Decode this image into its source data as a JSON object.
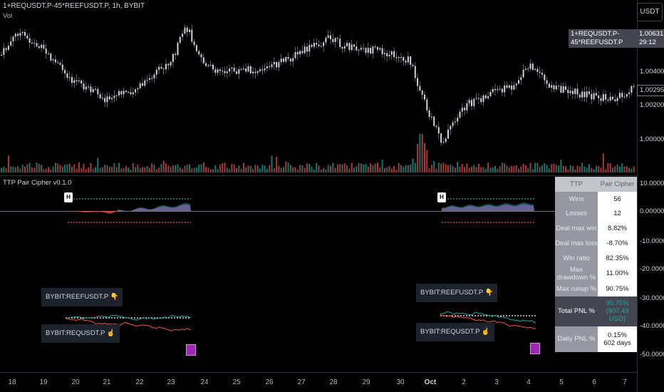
{
  "header": {
    "symbol_line": "1+REQUSDT.P-45*REEFUSDT.P, 1h, BYBIT",
    "vol_label": "Vol",
    "currency_button": "USDT"
  },
  "price_axis": {
    "labels": [
      "1.00400",
      "1.00200",
      "1.00000"
    ],
    "symbol_tag": "1+REQUSDT.P-45*REEFUSDT.P",
    "last_price": "1.00631",
    "countdown": "29:12",
    "cursor_price": "1.00295"
  },
  "indicator": {
    "title": "TTP Pair Cipher v0.1.0",
    "axis_labels": [
      "10.00000",
      "0.00000",
      "-10.00000",
      "-20.00000",
      "-30.00000",
      "-40.00000",
      "-50.00000"
    ],
    "flag_label": "H",
    "legs": {
      "short": "BYBIT:REEFUSDT.P 👇",
      "long": "BYBIT:REQUSDT.P ☝"
    }
  },
  "stats_table": {
    "header": [
      "TTP",
      "Pair Cipher"
    ],
    "rows": [
      {
        "k": "Wins",
        "v": "56"
      },
      {
        "k": "Losses",
        "v": "12"
      },
      {
        "k": "Deal max win",
        "v": "8.82%"
      },
      {
        "k": "Deal max loss",
        "v": "-8.70%"
      },
      {
        "k": "Win ratio",
        "v": "82.35%"
      },
      {
        "k": "Max drawdown %",
        "v": "11.00%"
      },
      {
        "k": "Max runup %",
        "v": "90.75%"
      }
    ],
    "total_label": "Total PNL %",
    "total_pct": "90.75%",
    "total_usd": "(907.49 USD)",
    "daily_label": "Daily PNL %",
    "daily_pct": "0.15%",
    "daily_days": "602 days"
  },
  "time_axis": [
    "18",
    "19",
    "20",
    "21",
    "22",
    "23",
    "24",
    "25",
    "26",
    "27",
    "28",
    "29",
    "30",
    "Oct",
    "2",
    "3",
    "4",
    "5",
    "6",
    "7"
  ],
  "colors": {
    "up": "#26a69a",
    "down": "#ef5350",
    "candle": "#d1d4dc",
    "panel": "#1e222d",
    "area": "#9c6ec4"
  }
}
